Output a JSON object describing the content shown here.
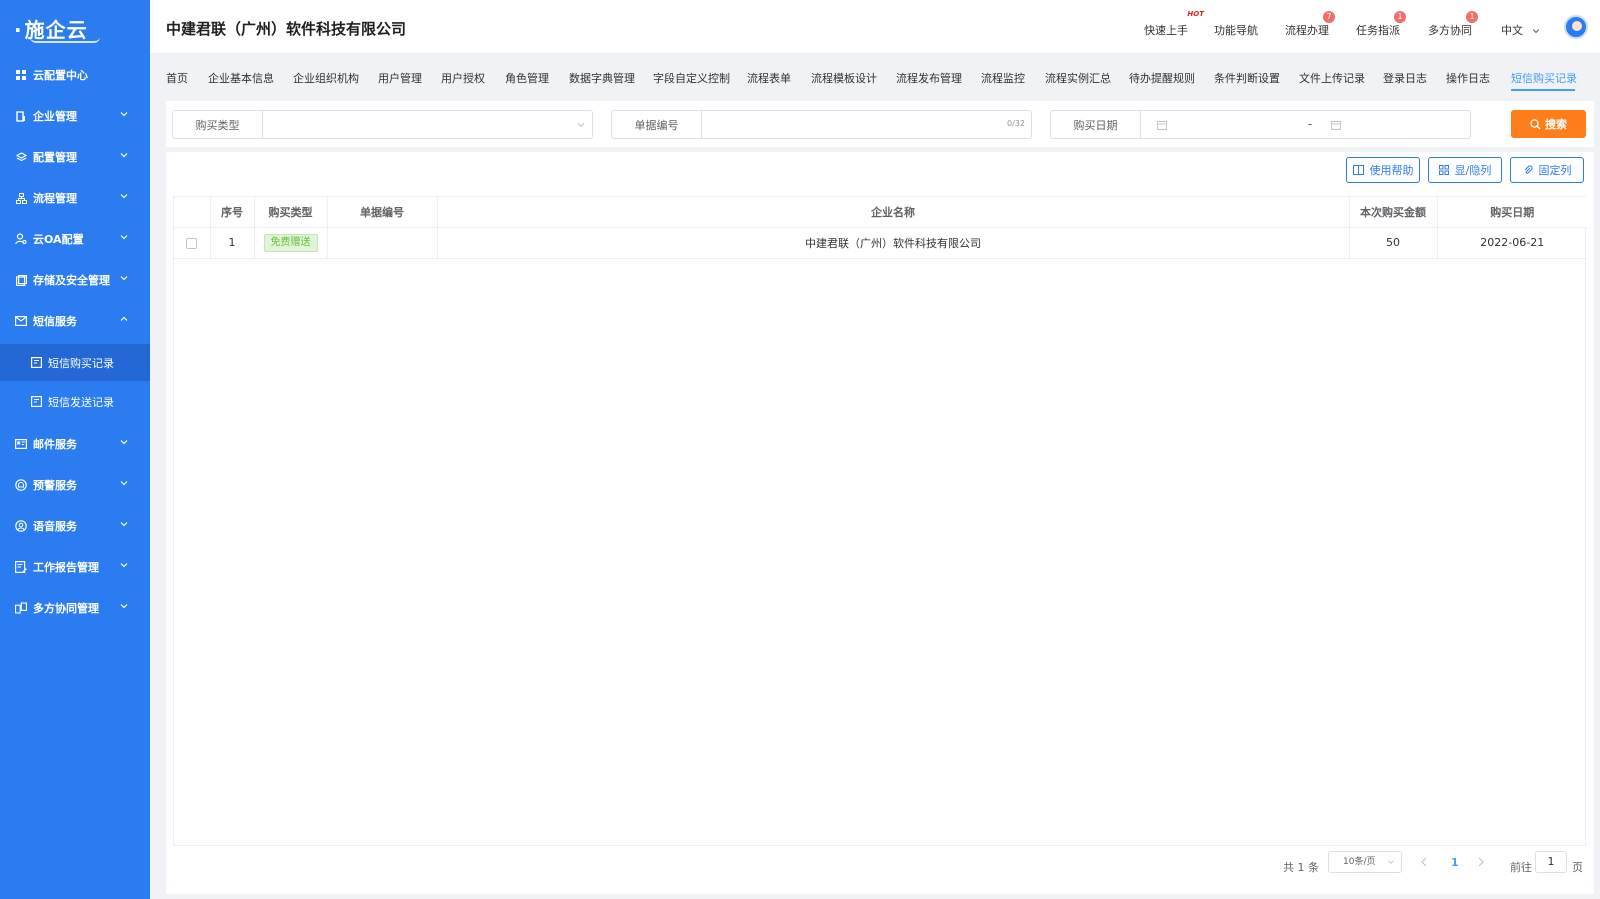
{
  "brand": {
    "logo_text": "施企云"
  },
  "header": {
    "company_title": "中建君联（广州）软件科技有限公司",
    "nav": [
      {
        "label": "快速上手",
        "badge": "HOT"
      },
      {
        "label": "功能导航",
        "badge": ""
      },
      {
        "label": "流程办理",
        "badge": "7"
      },
      {
        "label": "任务指派",
        "badge": "1"
      },
      {
        "label": "多方协同",
        "badge": "1"
      }
    ],
    "language": "中文"
  },
  "sidebar": {
    "items": [
      {
        "label": "云配置中心",
        "icon": "grid-icon"
      },
      {
        "label": "企业管理",
        "icon": "building-icon"
      },
      {
        "label": "配置管理",
        "icon": "layers-icon"
      },
      {
        "label": "流程管理",
        "icon": "flow-icon"
      },
      {
        "label": "云OA配置",
        "icon": "user-gear-icon"
      },
      {
        "label": "存储及安全管理",
        "icon": "storage-icon"
      },
      {
        "label": "短信服务",
        "icon": "mail-icon"
      },
      {
        "label": "短信购买记录",
        "icon": "doc-icon"
      },
      {
        "label": "短信发送记录",
        "icon": "doc-icon"
      },
      {
        "label": "邮件服务",
        "icon": "card-icon"
      },
      {
        "label": "预警服务",
        "icon": "alert-icon"
      },
      {
        "label": "语音服务",
        "icon": "voice-icon"
      },
      {
        "label": "工作报告管理",
        "icon": "report-icon"
      },
      {
        "label": "多方协同管理",
        "icon": "collab-icon"
      }
    ]
  },
  "tabs": [
    "首页",
    "企业基本信息",
    "企业组织机构",
    "用户管理",
    "用户授权",
    "角色管理",
    "数据字典管理",
    "字段自定义控制",
    "流程表单",
    "流程模板设计",
    "流程发布管理",
    "流程监控",
    "流程实例汇总",
    "待办提醒规则",
    "条件判断设置",
    "文件上传记录",
    "登录日志",
    "操作日志",
    "短信购买记录"
  ],
  "search": {
    "purchase_type_label": "购买类型",
    "purchase_type_value": "",
    "bill_no_label": "单据编号",
    "bill_no_counter": "0/32",
    "date_label": "购买日期",
    "date_separator": "-",
    "search_button": "搜索"
  },
  "toolbar": {
    "help_label": "使用帮助",
    "toggle_cols_label": "显/隐列",
    "fixed_cols_label": "固定列"
  },
  "table": {
    "columns": [
      "序号",
      "购买类型",
      "单据编号",
      "企业名称",
      "本次购买金额",
      "购买日期"
    ],
    "rows": [
      {
        "index": "1",
        "type": "免费赠送",
        "bill_no": "",
        "company": "中建君联（广州）软件科技有限公司",
        "amount": "50",
        "date": "2022-06-21"
      }
    ]
  },
  "pagination": {
    "total": "共 1 条",
    "page_size": "10条/页",
    "current_page": "1",
    "goto_label": "前往",
    "goto_value": "1",
    "page_suffix": "页"
  },
  "colors": {
    "sidebar": "#2b7cf0",
    "accent": "#409eff",
    "search_button": "#ff7d1a",
    "badge": "#f56c6c"
  }
}
